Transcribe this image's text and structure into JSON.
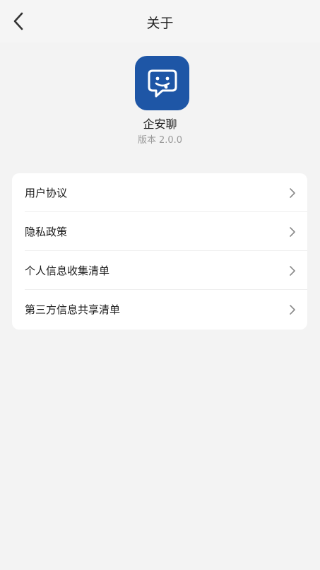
{
  "header": {
    "title": "关于",
    "back_icon": "chevron-left-icon"
  },
  "app": {
    "icon": "chat-bubble-smile-icon",
    "icon_color": "#1e56a6",
    "name": "企安聊",
    "version_label": "版本",
    "version": "2.0.0"
  },
  "menu": {
    "items": [
      {
        "label": "用户协议",
        "icon": "chevron-right-icon"
      },
      {
        "label": "隐私政策",
        "icon": "chevron-right-icon"
      },
      {
        "label": "个人信息收集清单",
        "icon": "chevron-right-icon"
      },
      {
        "label": "第三方信息共享清单",
        "icon": "chevron-right-icon"
      }
    ]
  }
}
